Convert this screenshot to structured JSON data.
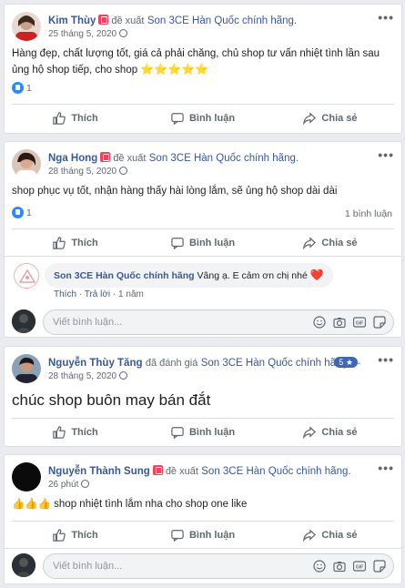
{
  "posts": [
    {
      "author": "Kim Thùy",
      "verb": "đề xuất",
      "page": "Son 3CE Hàn Quốc chính hãng.",
      "date": "25 tháng 5, 2020",
      "text": "Hàng đẹp, chất lượng tốt, giá cả phải chăng, chủ shop tư vấn nhiệt tình lần sau ủng hộ shop tiếp, cho shop ",
      "stars": "⭐⭐⭐⭐⭐",
      "reactions": "1"
    },
    {
      "author": "Nga Hong",
      "verb": "đề xuất",
      "page": "Son 3CE Hàn Quốc chính hãng.",
      "date": "28 tháng 5, 2020",
      "text": "shop phục vụ tốt, nhận hàng thấy hài lòng lắm, sẽ ủng hộ shop dài dài",
      "reactions": "1",
      "comment_count": "1 bình luận",
      "comment": {
        "page_name": "Son 3CE Hàn Quốc chính hãng",
        "text": "Vâng ạ. E cảm ơn chị nhé",
        "heart": "❤️",
        "like": "Thích",
        "reply": "Trả lời",
        "time": "1 năm"
      }
    },
    {
      "author": "Nguyễn Thùy Tăng",
      "verb": "đã đánh giá",
      "page": "Son 3CE Hàn Quốc chính hãng",
      "suffix": " — ",
      "rating": "5 ★",
      "date": "28 tháng 5, 2020",
      "text": "chúc shop buôn may bán đắt"
    },
    {
      "author": "Nguyễn Thành Sung",
      "verb": "đề xuất",
      "page": "Son 3CE Hàn Quốc chính hãng.",
      "date": "26 phút",
      "thumbs": "👍👍👍",
      "text": " shop nhiệt tình lắm nha cho shop one like"
    }
  ],
  "actions": {
    "like": "Thích",
    "comment": "Bình luận",
    "share": "Chia sẻ"
  },
  "write_placeholder": "Viết bình luận...",
  "more": "•••"
}
